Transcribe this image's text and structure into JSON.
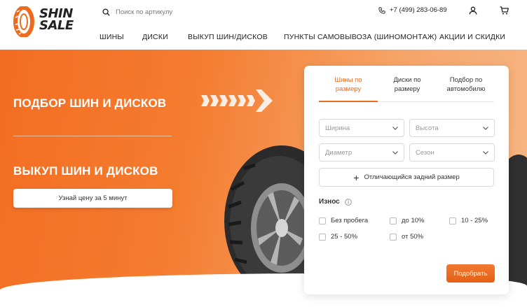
{
  "brand": {
    "logo_line1": "SHIN",
    "logo_line2": "SALE",
    "accent": "#ee6a1e"
  },
  "header": {
    "search_placeholder": "Поиск по артикулу",
    "phone": "+7 (499) 283-06-89",
    "icons": [
      "search-icon",
      "phone-icon",
      "user-icon",
      "cart-icon"
    ]
  },
  "nav": {
    "items": [
      {
        "label": "ШИНЫ"
      },
      {
        "label": "ДИСКИ"
      },
      {
        "label": "ВЫКУП ШИН/ДИСКОВ"
      },
      {
        "label": "ПУНКТЫ САМОВЫВОЗА (ШИНОМОНТАЖ)"
      },
      {
        "label": "АКЦИИ И СКИДКИ"
      }
    ]
  },
  "hero": {
    "title1": "ПОДБОР ШИН И ДИСКОВ",
    "title2": "ВЫКУП ШИН И ДИСКОВ",
    "price_button": "Узнай цену за 5 минут"
  },
  "panel": {
    "tabs": [
      {
        "line1": "Шины по",
        "line2": "размеру",
        "active": true
      },
      {
        "line1": "Диски по",
        "line2": "размеру",
        "active": false
      },
      {
        "line1": "Подбор по",
        "line2": "автомобилю",
        "active": false
      }
    ],
    "selects": {
      "width": "Ширина",
      "height": "Высота",
      "diameter": "Диаметр",
      "season": "Сезон"
    },
    "rear_size_button": "Отличающийся задний размер",
    "wear_label": "Износ",
    "wear_options": [
      "Без пробега",
      "до 10%",
      "10 - 25%",
      "25 - 50%",
      "от 50%"
    ],
    "submit": "Подобрать"
  }
}
